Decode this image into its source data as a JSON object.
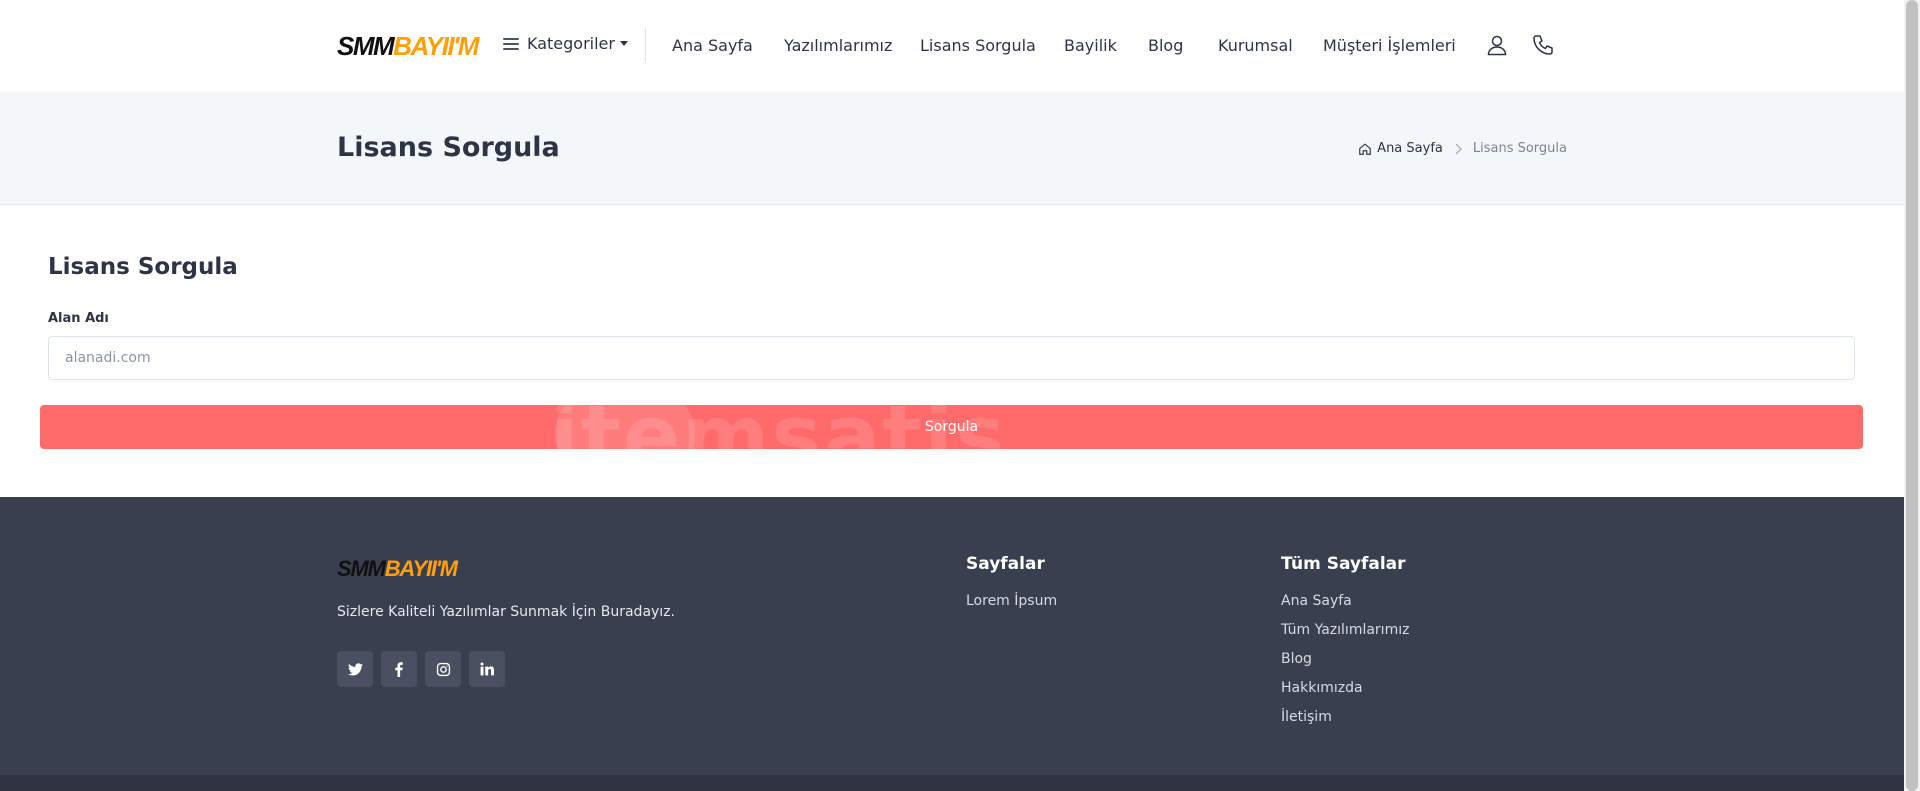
{
  "header": {
    "logo": {
      "part1": "SMM",
      "part2": "BAYII'M"
    },
    "categories_label": "Kategoriler",
    "nav": [
      "Ana Sayfa",
      "Yazılımlarımız",
      "Lisans Sorgula",
      "Bayilik",
      "Blog",
      "Kurumsal",
      "Müşteri İşlemleri"
    ],
    "icons": [
      "user-icon",
      "phone-icon"
    ]
  },
  "titlebar": {
    "title": "Lisans Sorgula",
    "breadcrumb": {
      "home": "Ana Sayfa",
      "current": "Lisans Sorgula"
    }
  },
  "form": {
    "title": "Lisans Sorgula",
    "label": "Alan Adı",
    "placeholder": "alanadi.com",
    "submit_label": "Sorgula",
    "watermark": "itemsatis"
  },
  "footer": {
    "logo": {
      "part1": "SMM",
      "part2": "BAYII'M"
    },
    "description": "Sizlere Kaliteli Yazılımlar Sunmak İçin Buradayız.",
    "social": [
      {
        "name": "twitter-icon",
        "glyph": "🐦"
      },
      {
        "name": "facebook-icon",
        "glyph": "f"
      },
      {
        "name": "instagram-icon",
        "glyph": "◎"
      },
      {
        "name": "linkedin-icon",
        "glyph": "in"
      }
    ],
    "col1": {
      "title": "Sayfalar",
      "links": [
        "Lorem İpsum"
      ]
    },
    "col2": {
      "title": "Tüm Sayfalar",
      "links": [
        "Ana Sayfa",
        "Tüm Yazılımlarımız",
        "Blog",
        "Hakkımızda",
        "İletişim"
      ]
    }
  },
  "colors": {
    "accent": "#ff6a6a",
    "logo_orange": "#ff9f0a",
    "footer_bg": "#3a3f50",
    "titlebar_bg": "#f3f7fa"
  }
}
